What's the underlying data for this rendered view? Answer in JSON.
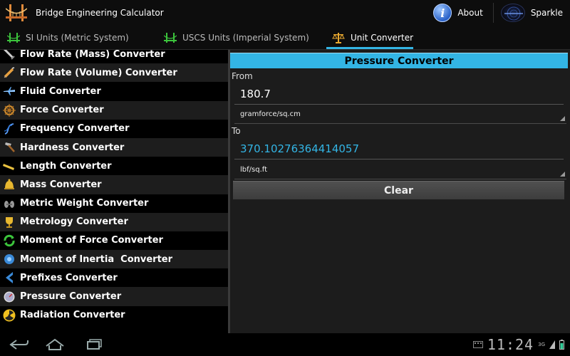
{
  "app": {
    "title": "Bridge Engineering Calculator"
  },
  "actions": {
    "about": "About",
    "sparkle": "Sparkle"
  },
  "tabs": [
    {
      "label": "SI Units (Metric System)",
      "icon": "bridge-icon",
      "active": false
    },
    {
      "label": "USCS Units (Imperial System)",
      "icon": "bridge-icon",
      "active": false
    },
    {
      "label": "Unit Converter",
      "icon": "scale-icon",
      "active": true
    }
  ],
  "converters": [
    {
      "label": "Flow Rate (Mass) Converter",
      "icon": "flow-mass-icon"
    },
    {
      "label": "Flow Rate (Volume) Converter",
      "icon": "syringe-icon"
    },
    {
      "label": "Fluid Converter",
      "icon": "airplane-icon"
    },
    {
      "label": "Force Converter",
      "icon": "ships-wheel-icon"
    },
    {
      "label": "Frequency Converter",
      "icon": "helix-icon"
    },
    {
      "label": "Hardness Converter",
      "icon": "hammer-icon"
    },
    {
      "label": "Length Converter",
      "icon": "ruler-icon"
    },
    {
      "label": "Mass Converter",
      "icon": "bell-icon"
    },
    {
      "label": "Metric Weight Converter",
      "icon": "weights-icon"
    },
    {
      "label": "Metrology Converter",
      "icon": "trophy-icon"
    },
    {
      "label": "Moment of Force Converter",
      "icon": "cycle-arrows-icon"
    },
    {
      "label": "Moment of Inertia  Converter",
      "icon": "inertia-icon"
    },
    {
      "label": "Prefixes Converter",
      "icon": "chevron-left-icon"
    },
    {
      "label": "Pressure Converter",
      "icon": "gauge-icon"
    },
    {
      "label": "Radiation Converter",
      "icon": "radiation-icon"
    }
  ],
  "converter": {
    "title": "Pressure Converter",
    "from_label": "From",
    "from_value": "180.7",
    "from_unit": "gramforce/sq.cm",
    "to_label": "To",
    "to_value": "370.10276364414057",
    "to_unit": "lbf/sq.ft",
    "clear_label": "Clear"
  },
  "status": {
    "clock": "11:24",
    "network": "3G"
  },
  "colors": {
    "accent": "#33b5e5",
    "panel_bg": "#1c1c1c",
    "list_alt_bg": "#1d1d1d"
  }
}
